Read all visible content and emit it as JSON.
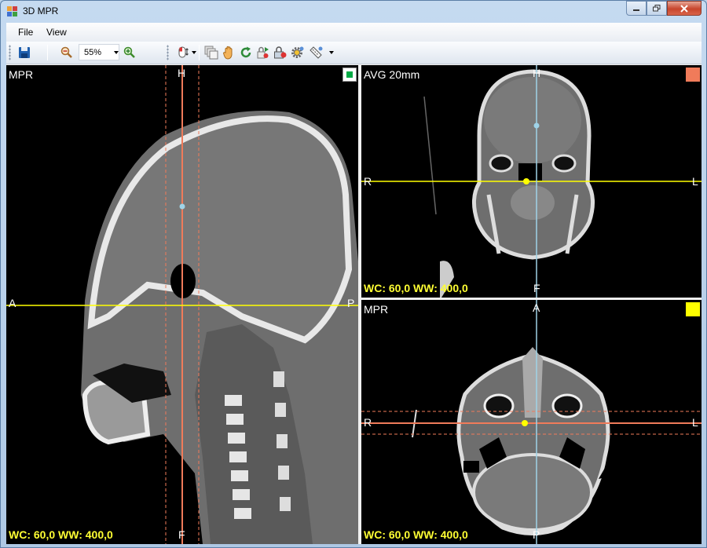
{
  "window": {
    "title": "3D MPR"
  },
  "menu": {
    "file": "File",
    "view": "View"
  },
  "toolbar": {
    "zoom_value": "55%"
  },
  "viewports": {
    "sagittal": {
      "label": "MPR",
      "wcww": "WC: 60,0 WW: 400,0",
      "top": "H",
      "bottom": "F",
      "left": "A",
      "right": "P",
      "indicator_color": "#00aa44"
    },
    "coronal": {
      "label": "AVG 20mm",
      "wcww": "WC: 60,0 WW: 400,0",
      "top": "H",
      "bottom": "F",
      "left": "R",
      "right": "L",
      "indicator_color": "#f07b5a"
    },
    "axial": {
      "label": "MPR",
      "wcww": "WC: 60,0 WW: 400,0",
      "top": "A",
      "bottom": "P",
      "left": "R",
      "right": "L",
      "indicator_color": "#ffff00"
    }
  },
  "colors": {
    "crosshair_yellow": "#ffff00",
    "crosshair_orange": "#f07b5a",
    "crosshair_blue": "#9fd3e8"
  }
}
